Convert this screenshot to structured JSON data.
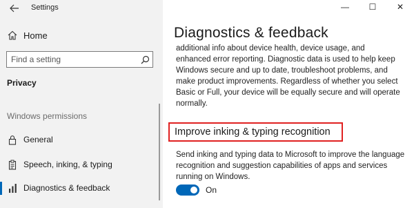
{
  "window": {
    "app_title": "Settings",
    "controls": {
      "minimize": "—",
      "maximize": "☐",
      "close": "✕"
    }
  },
  "sidebar": {
    "back_icon": "arrow-left-icon",
    "home_label": "Home",
    "search": {
      "placeholder": "Find a setting"
    },
    "section_title": "Privacy",
    "group_header": "Windows permissions",
    "items": [
      {
        "label": "General",
        "icon": "lock-icon",
        "active": false
      },
      {
        "label": "Speech, inking, & typing",
        "icon": "clipboard-icon",
        "active": false
      },
      {
        "label": "Diagnostics & feedback",
        "icon": "feedback-icon",
        "active": true
      }
    ]
  },
  "main": {
    "title": "Diagnostics & feedback",
    "diagnostic_paragraph_lines": [
      "additional info about device health, device usage, and",
      "enhanced error reporting. Diagnostic data is used to help keep",
      "Windows secure and up to date, troubleshoot problems, and",
      "make product improvements. Regardless of whether you select",
      "Basic or Full, your device will be equally secure and will operate",
      "normally."
    ],
    "inking_heading": "Improve inking & typing recognition",
    "inking_paragraph_lines": [
      "Send inking and typing data to Microsoft to improve the language",
      "recognition and suggestion capabilities of apps and services",
      "running on Windows."
    ],
    "toggle": {
      "state_label": "On",
      "on": true
    }
  },
  "colors": {
    "accent": "#0067b8",
    "highlight_border": "#e02020",
    "sidebar_bg": "#f2f2f2"
  }
}
